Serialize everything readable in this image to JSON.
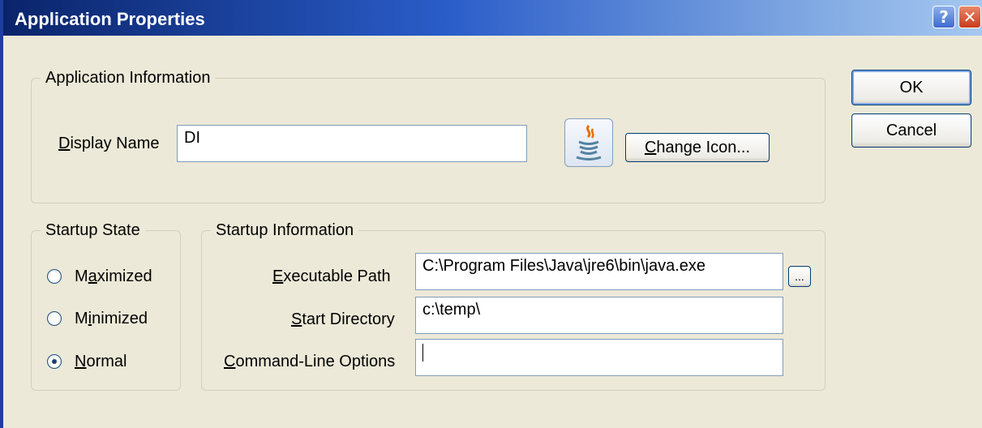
{
  "window": {
    "title": "Application Properties",
    "help_glyph": "?",
    "close_glyph": "✕"
  },
  "app_info": {
    "legend": "Application Information",
    "display_name_label": "Display Name",
    "display_name_value": "DI",
    "change_icon_label": "Change Icon...",
    "icon": "java-cup-icon"
  },
  "startup_state": {
    "legend": "Startup State",
    "options": [
      {
        "label": "Maximized",
        "checked": false
      },
      {
        "label": "Minimized",
        "checked": false
      },
      {
        "label": "Normal",
        "checked": true
      }
    ]
  },
  "startup_info": {
    "legend": "Startup Information",
    "executable_label": "Executable Path",
    "executable_value": "C:\\Program Files\\Java\\jre6\\bin\\java.exe",
    "browse_label": "...",
    "start_dir_label": "Start Directory",
    "start_dir_value": "c:\\temp\\",
    "cmdline_label": "Command-Line Options",
    "cmdline_value": ""
  },
  "buttons": {
    "ok": "OK",
    "cancel": "Cancel"
  },
  "colors": {
    "dialog_bg": "#ECE9D8",
    "title_gradient_start": "#0A246A",
    "title_gradient_end": "#A6C8F0",
    "selected_radio": "#21A121"
  }
}
